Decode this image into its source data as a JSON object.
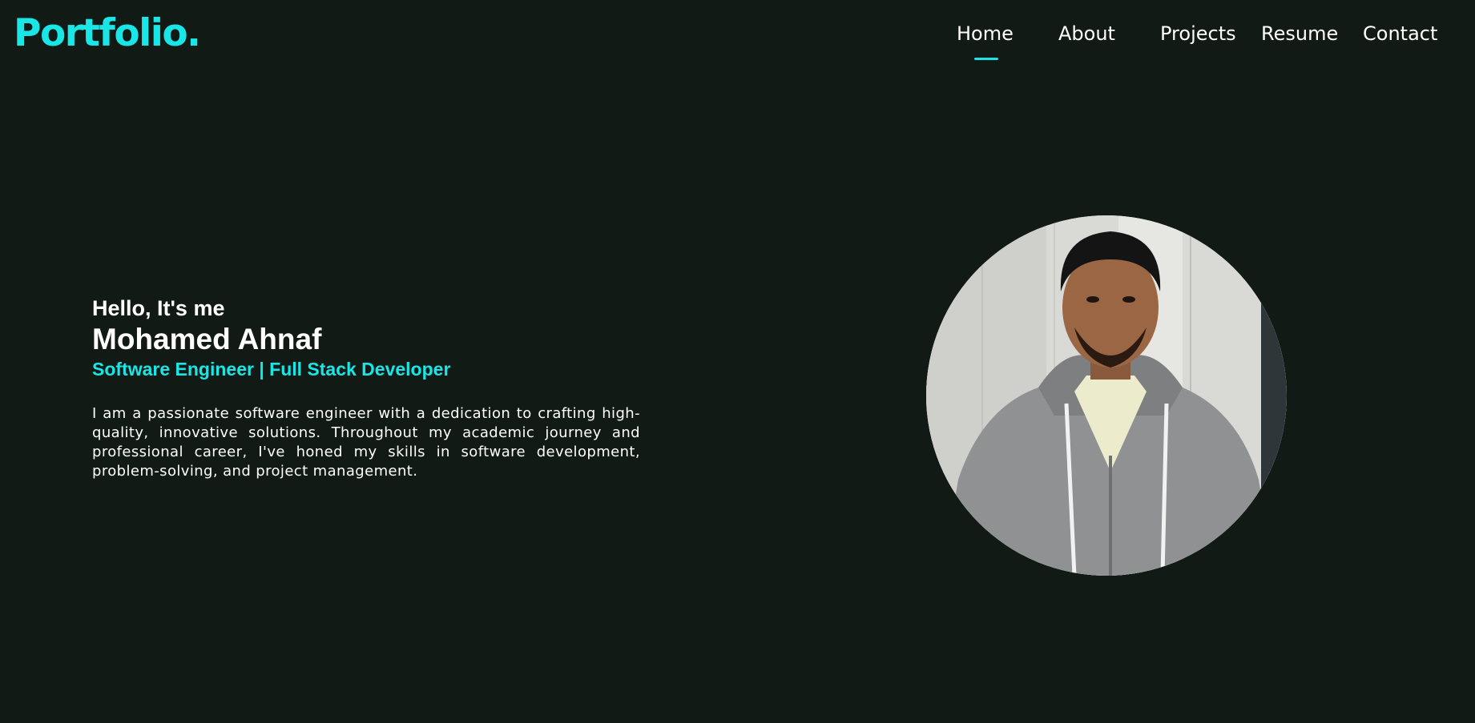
{
  "header": {
    "logo": "Portfolio.",
    "nav": {
      "home": "Home",
      "about": "About",
      "projects": "Projects",
      "resume": "Resume",
      "contact": "Contact"
    },
    "active_item": "Home"
  },
  "hero": {
    "greeting": "Hello, It's me",
    "name": "Mohamed Ahnaf",
    "role": "Software Engineer | Full Stack Developer",
    "bio": "I am a passionate software engineer with a dedication to crafting high-quality, innovative solutions. Throughout my academic journey and professional career, I've honed my skills in software development, problem-solving, and project management."
  },
  "colors": {
    "background": "#111a14",
    "accent": "#19e6e6",
    "text": "#ffffff"
  }
}
